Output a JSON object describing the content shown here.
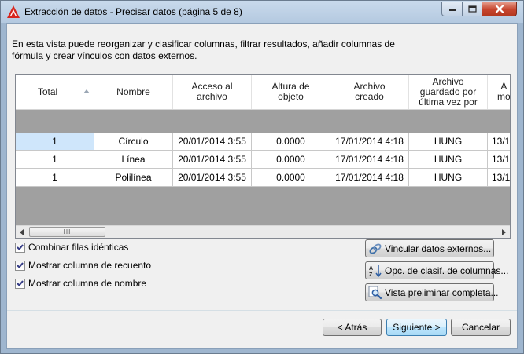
{
  "window": {
    "title": "Extracción de datos - Precisar datos (página 5 de 8)",
    "close_glyph": "x"
  },
  "description": "En esta vista puede reorganizar y clasificar columnas, filtrar resultados, añadir columnas de fórmula y crear vínculos con datos externos.",
  "grid": {
    "columns": [
      {
        "label": "Total",
        "sorted": "ascending"
      },
      {
        "label": "Nombre"
      },
      {
        "label": "Acceso al\narchivo"
      },
      {
        "label": "Altura de\nobjeto"
      },
      {
        "label": "Archivo\ncreado"
      },
      {
        "label": "Archivo\nguardado por\núltima vez por"
      },
      {
        "label": "A\nmo"
      }
    ],
    "rows": [
      [
        "1",
        "Círculo",
        "20/01/2014 3:55",
        "0.0000",
        "17/01/2014 4:18",
        "HUNG",
        "13/1"
      ],
      [
        "1",
        "Línea",
        "20/01/2014 3:55",
        "0.0000",
        "17/01/2014 4:18",
        "HUNG",
        "13/1"
      ],
      [
        "1",
        "Polilínea",
        "20/01/2014 3:55",
        "0.0000",
        "17/01/2014 4:18",
        "HUNG",
        "13/1"
      ]
    ],
    "scroll_thumb_grip": "III"
  },
  "options": {
    "combine_identical": {
      "label": "Combinar filas idénticas",
      "checked": true
    },
    "show_count": {
      "label": "Mostrar columna de recuento",
      "checked": true
    },
    "show_name": {
      "label": "Mostrar columna de nombre",
      "checked": true
    }
  },
  "side_buttons": {
    "link_external": {
      "label": "Vincular datos externos...",
      "icon": "link-icon"
    },
    "sort_options": {
      "label": "Opc. de clasif. de columnas...",
      "icon": "sort-az-icon"
    },
    "full_preview": {
      "label": "Vista preliminar completa...",
      "icon": "magnifier-icon"
    }
  },
  "nav": {
    "back": "< Atrás",
    "next": "Siguiente >",
    "cancel": "Cancelar"
  },
  "colors": {
    "accent": "#3c7fb1",
    "grid_empty": "#a0a0a0",
    "selection": "#cfe6fb",
    "close_red": "#c7462f"
  }
}
